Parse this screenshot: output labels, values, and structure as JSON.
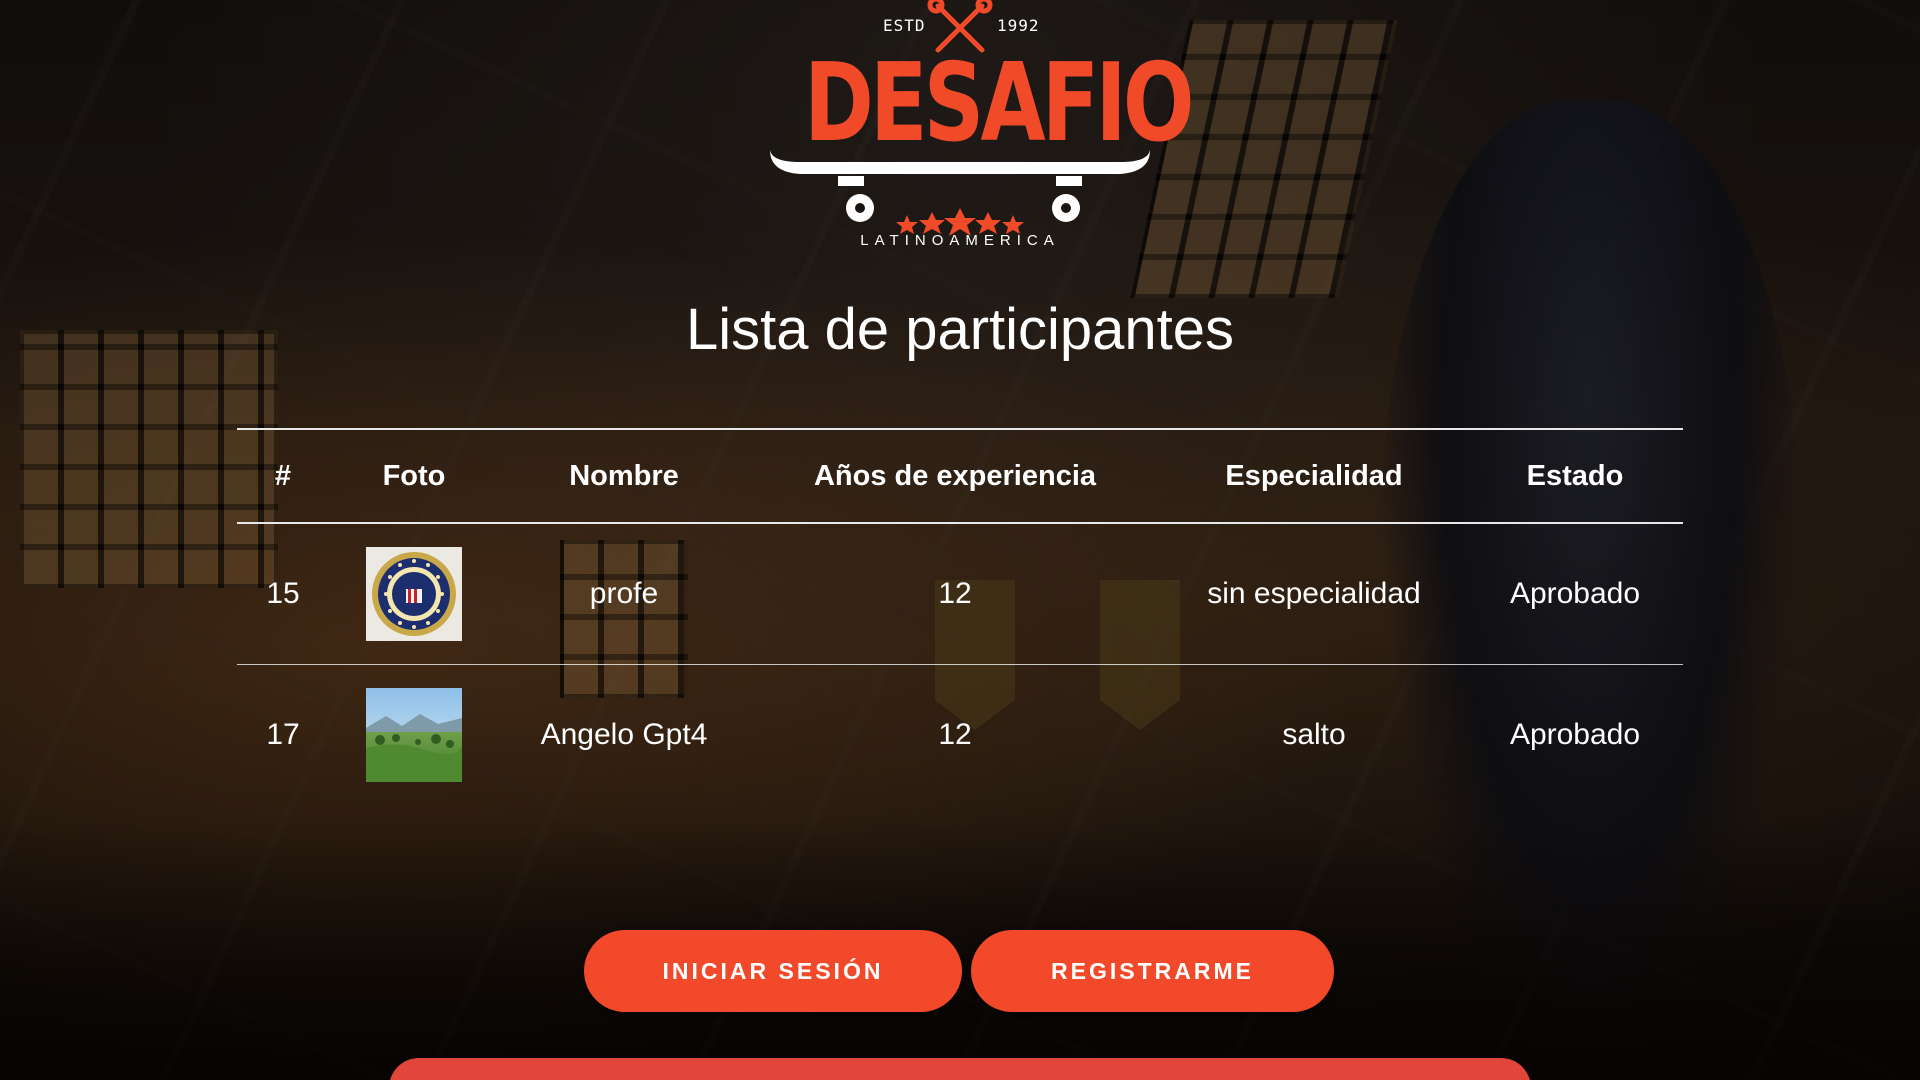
{
  "brand": {
    "est": "ESTD",
    "year": "1992",
    "name": "DESAFIO",
    "subtitle": "LATINOAMERICA"
  },
  "page_title": "Lista de participantes",
  "table": {
    "headers": [
      "#",
      "Foto",
      "Nombre",
      "Años de experiencia",
      "Especialidad",
      "Estado"
    ],
    "rows": [
      {
        "id": "15",
        "photo": "seal-photo",
        "name": "profe",
        "years": "12",
        "specialty": "sin especialidad",
        "status": "Aprobado"
      },
      {
        "id": "17",
        "photo": "landscape-photo",
        "name": "Angelo Gpt4",
        "years": "12",
        "specialty": "salto",
        "status": "Aprobado"
      }
    ]
  },
  "buttons": {
    "login": "INICIAR SESIÓN",
    "register": "REGISTRARME"
  },
  "colors": {
    "accent": "#f2492a",
    "brand_red": "#f04a28",
    "text": "#ffffff"
  },
  "icons": {
    "logo_crossed_tools": "crossed-wrenches-icon",
    "logo_skateboard": "skateboard-icon",
    "logo_stars": "stars-icon"
  }
}
